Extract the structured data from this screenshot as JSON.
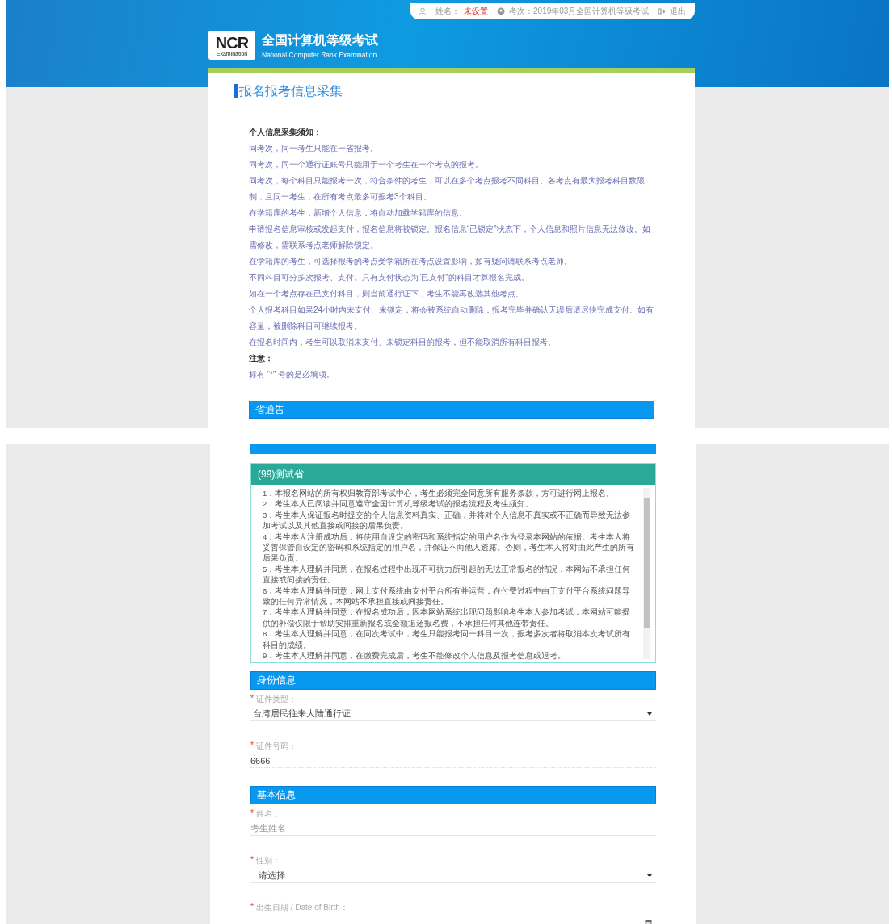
{
  "top_bar": {
    "user_label": "姓名：",
    "user_value": "未设置",
    "exam_label": "考次：",
    "exam_value": "2019年03月全国计算机等级考试",
    "logout": "退出"
  },
  "brand": {
    "logo_mark": "NCR",
    "logo_caption": "Examination",
    "title": "全国计算机等级考试",
    "subtitle": "National Computer Rank Examination"
  },
  "page_title": "报名报考信息采集",
  "notice": {
    "heading": "个人信息采集须知：",
    "items": [
      "同考次，同一考生只能在一省报考。",
      "同考次，同一个通行证账号只能用于一个考生在一个考点的报考。",
      "同考次，每个科目只能报考一次，符合条件的考生，可以在多个考点报考不同科目。各考点有最大报考科目数限制，且同一考生，在所有考点最多可报考3个科目。",
      "在学籍库的考生，新增个人信息，将自动加载学籍库的信息。",
      "申请报名信息审核或发起支付，报名信息将被锁定。报名信息“已锁定”状态下，个人信息和照片信息无法修改。如需修改，需联系考点老师解除锁定。",
      "在学籍库的考生，可选择报考的考点受学籍所在考点设置影响，如有疑问请联系考点老师。",
      "不同科目可分多次报考、支付。只有支付状态为“已支付”的科目才算报名完成。",
      "如在一个考点存在已支付科目，则当前通行证下，考生不能再改选其他考点。",
      "个人报考科目如果24小时内未支付、未锁定，将会被系统自动删除，报考完毕并确认无误后请尽快完成支付。如有容量，被删除科目可继续报考。",
      "在报名时间内，考生可以取消未支付、未锁定科目的报考，但不能取消所有科目报考。"
    ],
    "note_heading": "注意：",
    "note": {
      "before": "标有 ",
      "mark": "“*”",
      "after": " 号的是必填项。"
    }
  },
  "province_notice": {
    "title": "省通告"
  },
  "province": {
    "title": "(99)测试省",
    "terms": [
      "1．本报名网站的所有权归教育部考试中心，考生必须完全同意所有服务条款，方可进行网上报名。",
      "2．考生本人已阅读并同意遵守全国计算机等级考试的报名流程及考生须知。",
      "3．考生本人保证报名时提交的个人信息资料真实、正确，并将对个人信息不真实或不正确而导致无法参加考试以及其他直接或间接的后果负责。",
      "4．考生本人注册成功后，将使用自设定的密码和系统指定的用户名作为登录本网站的依据。考生本人将妥善保管自设定的密码和系统指定的用户名，并保证不向他人透露。否则，考生本人将对由此产生的所有后果负责。",
      "5．考生本人理解并同意，在报名过程中出现不可抗力所引起的无法正常报名的情况，本网站不承担任何直接或间接的责任。",
      "6．考生本人理解并同意，网上支付系统由支付平台所有并运营，在付费过程中由于支付平台系统问题导致的任何异常情况，本网站不承担直接或间接责任。",
      "7．考生本人理解并同意，在报名成功后，因本网站系统出现问题影响考生本人参加考试，本网站可能提供的补偿仅限于帮助安排重新报名或全额退还报名费，不承担任何其他连带责任。",
      "8．考生本人理解并同意，在同次考试中，考生只能报考同一科目一次，报考多次者将取消本次考试所有科目的成绩。",
      "9．考生本人理解并同意，在缴费完成后，考生不能修改个人信息及报考信息或退考。"
    ]
  },
  "required_mark": "*",
  "sections": [
    {
      "title": "身份信息",
      "fields": [
        {
          "kind": "select",
          "required": true,
          "label": "证件类型：",
          "value": "台湾居民往来大陆通行证"
        },
        {
          "kind": "text",
          "required": true,
          "label": "证件号码：",
          "value": "6666"
        }
      ]
    },
    {
      "title": "基本信息",
      "fields": [
        {
          "kind": "text",
          "required": true,
          "label": "姓名：",
          "placeholder": "考生姓名"
        },
        {
          "kind": "select",
          "required": true,
          "label": "性别：",
          "value": "- 请选择 -"
        },
        {
          "kind": "date",
          "required": true,
          "label": "出生日期 / Date of Birth："
        }
      ]
    }
  ]
}
